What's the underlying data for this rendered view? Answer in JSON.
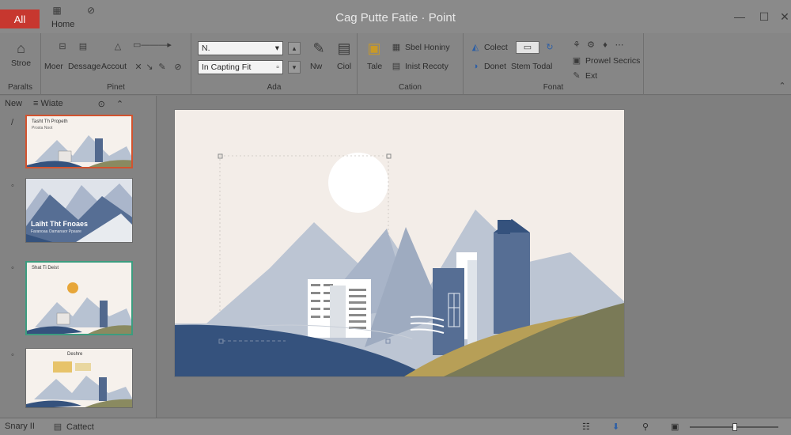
{
  "titlebar": {
    "app_button": "All",
    "home_tab": "Home",
    "title": "Cag Putte Fatie",
    "title_suffix": "Point"
  },
  "ribbon": {
    "groups": [
      {
        "label": "Paralts"
      },
      {
        "label": "Pinet"
      },
      {
        "label": "Ada"
      },
      {
        "label": "Cation"
      },
      {
        "label": "Fonat"
      }
    ],
    "stroe_label": "Stroe",
    "moer_label": "Moer",
    "dessage_label": "Dessage",
    "accout_label": "Accout",
    "font_name_value": "N.",
    "font_size_value": "In Capting Fit",
    "new_label": "Nw",
    "ciol_label": "Ciol",
    "tale_label": "Tale",
    "sbel_honiny": "Sbel Honiny",
    "inist_recoty": "Inist Recoty",
    "colect_label": "Colect",
    "donet_label": "Donet",
    "stem_todal": "Stem Todal",
    "prowel_secrics": "Prowel Secrics",
    "ext_label": "Ext"
  },
  "panel": {
    "new_label": "New",
    "view_label": "Wiate",
    "thumb1_title": "Tasht Th Propeth",
    "thumb1_sub": "Prosta Noot",
    "thumb2_title": "Laiht Tht Fnoaes",
    "thumb2_sub": "Faranoaa Oamanaor Ppaare",
    "thumb3_title": "Shat Ti Deist",
    "thumb4_title": "Deshre"
  },
  "statusbar": {
    "slide_label": "Snary II",
    "cattect_label": "Cattect"
  },
  "colors": {
    "accent_red": "#c7372f",
    "mountain_blue": "#566e94",
    "dark_navy": "#35527d",
    "olive": "#7a7a57",
    "mustard": "#b79f57",
    "sun_orange": "#e7a639"
  }
}
